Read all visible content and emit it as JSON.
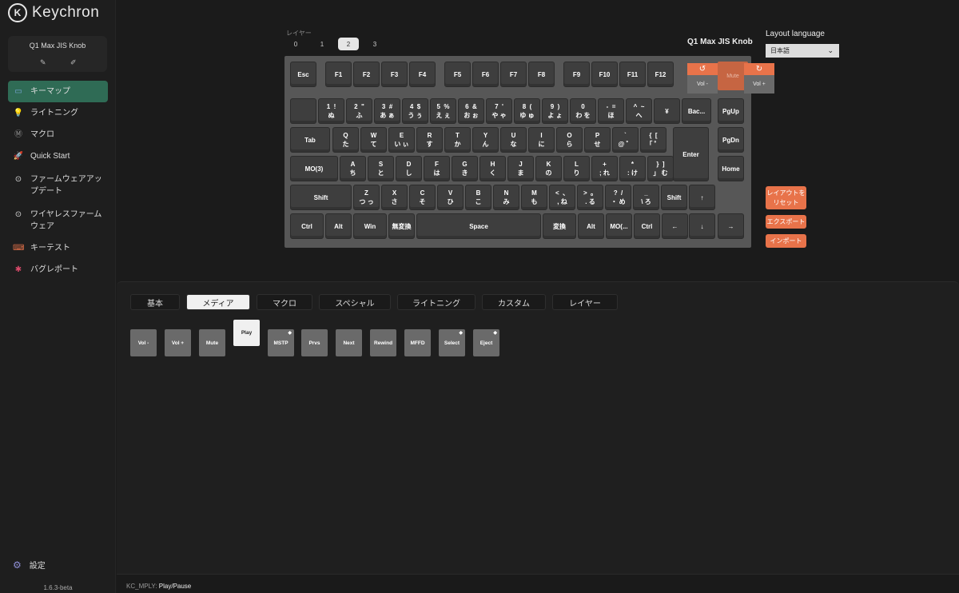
{
  "app": {
    "brand": "Keychron",
    "logo_letter": "K",
    "version": "1.6.3-beta"
  },
  "device": {
    "name": "Q1 Max JIS Knob",
    "edit_icon": "pencil-icon",
    "rename_icon": "pencil-icon"
  },
  "nav": [
    {
      "label": "キーマップ",
      "icon": "keyboard-icon"
    },
    {
      "label": "ライトニング",
      "icon": "bulb-icon"
    },
    {
      "label": "マクロ",
      "icon": "macro-icon"
    },
    {
      "label": "Quick Start",
      "icon": "rocket-icon"
    },
    {
      "label": "ファームウェアアップデート",
      "icon": "update-icon"
    },
    {
      "label": "ワイヤレスファームウェア",
      "icon": "wireless-icon"
    },
    {
      "label": "キーテスト",
      "icon": "keytest-icon"
    },
    {
      "label": "バグレポート",
      "icon": "bug-icon"
    }
  ],
  "settings_label": "設定",
  "layers": {
    "label": "レイヤー",
    "items": [
      "0",
      "1",
      "2",
      "3"
    ],
    "active": "2"
  },
  "keyboard_title": "Q1 Max JIS Knob",
  "layout_language": {
    "label": "Layout language",
    "value": "日本語"
  },
  "knob": {
    "ccw_label": "Vol -",
    "press_label": "Mute",
    "cw_label": "Vol +"
  },
  "actions": {
    "reset": "レイアウトを\nリセット",
    "export": "エクスポート",
    "import": "インポート"
  },
  "rows": {
    "r0": [
      "Esc",
      "F1",
      "F2",
      "F3",
      "F4",
      "F5",
      "F6",
      "F7",
      "F8",
      "F9",
      "F10",
      "F11",
      "F12"
    ],
    "r1": [
      "",
      "1  !\nぬ",
      "2  \"\nふ",
      "3  #\nあ ぁ",
      "4  $\nう ぅ",
      "5  %\nえ ぇ",
      "6  &\nお ぉ",
      "7  '\nや ゃ",
      "8  (\nゆ ゅ",
      "9  )\nよ ょ",
      "0\nわ を",
      "-  =\nほ",
      "^  ~\nへ",
      "¥",
      "Bac...",
      "PgUp"
    ],
    "r2": [
      "Tab",
      "Q\nた",
      "W\nて",
      "E\nい ぃ",
      "R\nす",
      "T\nか",
      "Y\nん",
      "U\nな",
      "I\nに",
      "O\nら",
      "P\nせ",
      "`\n@ ゛",
      "{  [\n「 ゜",
      "Enter",
      "PgDn"
    ],
    "r3": [
      "MO(3)",
      "A\nち",
      "S\nと",
      "D\nし",
      "F\nは",
      "G\nき",
      "H\nく",
      "J\nま",
      "K\nの",
      "L\nり",
      "+\n; れ",
      "*\n: け",
      "}  ]\n」 む",
      "Home"
    ],
    "r4": [
      "Shift",
      "Z\nつ っ",
      "X\nさ",
      "C\nそ",
      "V\nひ",
      "B\nこ",
      "N\nみ",
      "M\nも",
      "<  、\n, ね",
      ">  。\n. る",
      "?  /\n・ め",
      "_\n\\ ろ",
      "Shift",
      "↑"
    ],
    "r5": [
      "Ctrl",
      "Alt",
      "Win",
      "無変換",
      "Space",
      "変換",
      "Alt",
      "MO(...",
      "Ctrl",
      "←",
      "↓",
      "→"
    ]
  },
  "tabs": [
    {
      "label": "基本"
    },
    {
      "label": "メディア",
      "active": true
    },
    {
      "label": "マクロ"
    },
    {
      "label": "スペシャル"
    },
    {
      "label": "ライトニング"
    },
    {
      "label": "カスタム"
    },
    {
      "label": "レイヤー"
    }
  ],
  "media_keys": [
    "Vol -",
    "Vol +",
    "Mute",
    "Play",
    "MSTP",
    "Prvs",
    "Next",
    "Rewind",
    "MFFD",
    "Select",
    "Eject"
  ],
  "media_active": "Play",
  "status": {
    "code": "KC_MPLY:",
    "desc": "Play/Pause"
  },
  "colors": {
    "accent": "#e8734a",
    "nav_active": "#2f6b55",
    "bg": "#1b1b1b"
  }
}
